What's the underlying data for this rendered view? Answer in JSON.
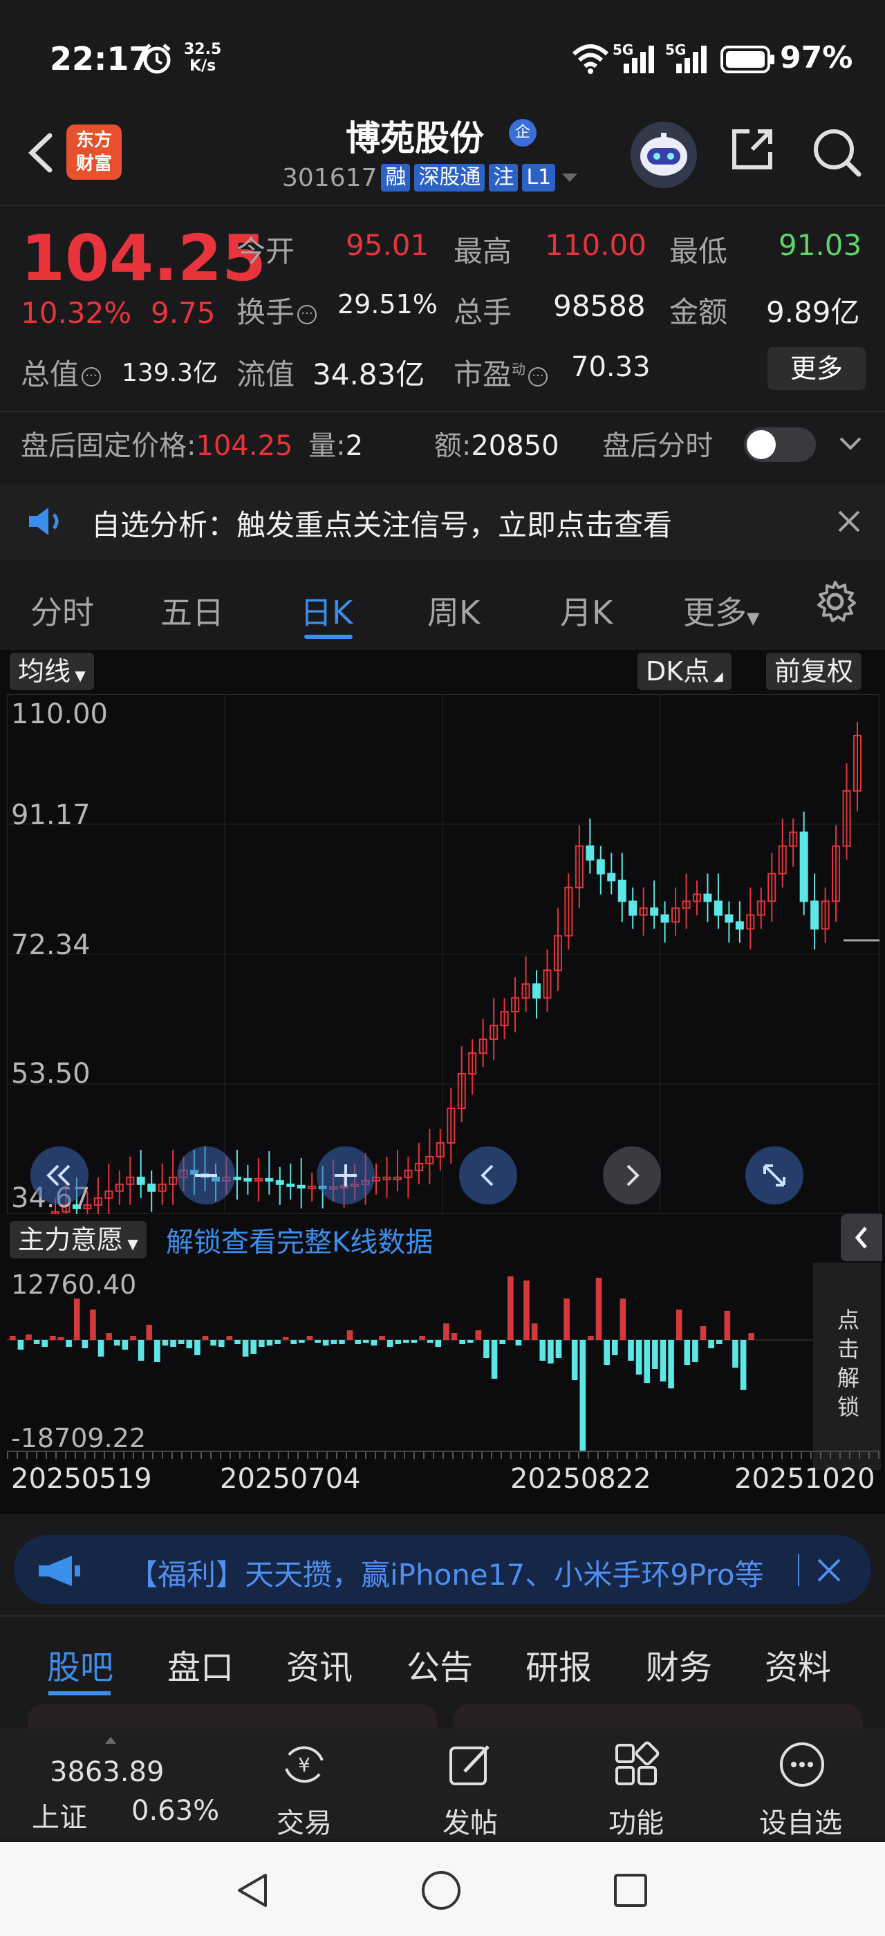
{
  "status_bar": {
    "time": "22:17",
    "speed_value": "32.5",
    "speed_unit": "K/s",
    "network1": "5G",
    "network2": "5G",
    "battery": "97%"
  },
  "header": {
    "logo_text_1": "东方",
    "logo_text_2": "财富",
    "name": "博苑股份",
    "badge": "企",
    "code": "301617",
    "tags": [
      "融",
      "深股通",
      "注",
      "L1"
    ]
  },
  "quote": {
    "price": "104.25",
    "change_pct": "10.32%",
    "change_abs": "9.75",
    "open_label": "今开",
    "open": "95.01",
    "high_label": "最高",
    "high": "110.00",
    "low_label": "最低",
    "low": "91.03",
    "turnover_label": "换手",
    "turnover": "29.51%",
    "volume_label": "总手",
    "volume": "98588",
    "amount_label": "金额",
    "amount": "9.89亿",
    "mktcap_label": "总值",
    "mktcap": "139.3亿",
    "float_label": "流值",
    "float": "34.83亿",
    "pe_label": "市盈",
    "pe_sup": "动",
    "pe": "70.33",
    "more": "更多"
  },
  "after_hours": {
    "price_label": "盘后固定价格:",
    "price": "104.25",
    "qty_label": "量:",
    "qty": "2",
    "amt_label": "额:",
    "amt": "20850",
    "toggle_label": "盘后分时"
  },
  "alert": {
    "text": "自选分析：触发重点关注信号，立即点击查看"
  },
  "kline_tabs": [
    "分时",
    "五日",
    "日K",
    "周K",
    "月K",
    "更多"
  ],
  "chart": {
    "ma_chip": "均线",
    "dk_chip": "DK点",
    "adj_chip": "前复权",
    "y_labels": [
      "110.00",
      "91.17",
      "72.34",
      "53.50",
      "34.67"
    ],
    "indicator_chip": "主力意愿",
    "unlock_text": "解锁查看完整K线数据",
    "ind_max": "12760.40",
    "ind_min": "-18709.22",
    "side_unlock": "点击解锁",
    "dates": [
      "20250519",
      "20250704",
      "20250822",
      "20251020"
    ]
  },
  "chart_data": {
    "type": "candlestick",
    "y_range": [
      34.67,
      110.0
    ],
    "last_close": 104.25
  },
  "promo": {
    "text": "【福利】天天攒，赢iPhone17、小米手环9Pro等"
  },
  "info_tabs": [
    "股吧",
    "盘口",
    "资讯",
    "公告",
    "研报",
    "财务",
    "资料"
  ],
  "bottom_bar": {
    "index_value": "3863.89",
    "index_name": "上证",
    "index_change": "0.63%",
    "trade": "交易",
    "post": "发帖",
    "functions": "功能",
    "watchlist": "设自选"
  }
}
